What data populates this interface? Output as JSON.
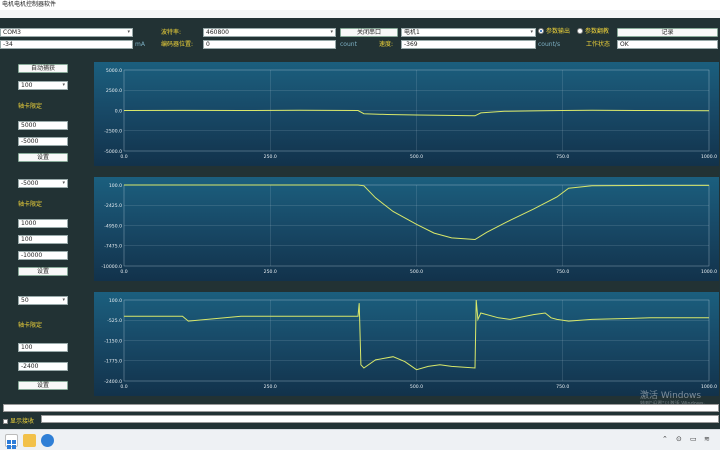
{
  "window": {
    "title": "电机电机控制器软件"
  },
  "top": {
    "port_value": "COM3",
    "baud_label": "波特率:",
    "baud_value": "460800",
    "close_port_label": "关闭串口",
    "motor_value": "电机1",
    "radio_output_label": "参数输出",
    "radio_read_label": "参数翻教",
    "record_label": "记录",
    "current_value": "-34",
    "current_unit": "mA",
    "encoder_label": "编码器位置:",
    "encoder_value": "0",
    "encoder_unit": "count",
    "speed_label": "速度:",
    "speed_value": "-369",
    "speed_unit": "count/s",
    "work_state_label": "工作状态",
    "work_state_value": "OK"
  },
  "left_panel": {
    "auto_capture_label": "自动捕获",
    "p1": {
      "select_value": "100",
      "axis_label": "轴卡限定",
      "max_value": "5000",
      "min_value": "-5000",
      "set_label": "设置"
    },
    "p2": {
      "select_value": "-5000",
      "axis_label": "轴卡限定",
      "v1": "1000",
      "v2": "100",
      "v3": "-10000",
      "set_label": "设置"
    },
    "p3": {
      "select_value": "50",
      "axis_label": "轴卡限定",
      "v1": "100",
      "v2": "-2400",
      "set_label": "设置"
    }
  },
  "bottom": {
    "show_receive_label": "显示接收"
  },
  "watermark": {
    "title": "激活 Windows",
    "subtitle": "转到\"设置\"以激活 Windows。"
  },
  "taskbar": {
    "tray_time": ""
  },
  "chart_data": [
    {
      "type": "line",
      "title": "",
      "xlim": [
        0,
        1000
      ],
      "ylim": [
        -5000,
        5000
      ],
      "x_ticks": [
        "0.0",
        "250.0",
        "500.0",
        "750.0",
        "1000.0"
      ],
      "y_ticks": [
        "5000.0",
        "2500.0",
        "0.0",
        "-2500.0",
        "-5000.0"
      ],
      "series": [
        {
          "color": "#d9e86a",
          "x": [
            0,
            100,
            200,
            300,
            400,
            410,
            450,
            500,
            550,
            600,
            610,
            650,
            700,
            750,
            800,
            900,
            1000
          ],
          "y": [
            0,
            10,
            0,
            30,
            0,
            -400,
            -500,
            -550,
            -600,
            -650,
            -300,
            -100,
            -50,
            0,
            20,
            0,
            -20
          ]
        }
      ]
    },
    {
      "type": "line",
      "title": "",
      "xlim": [
        0,
        1000
      ],
      "ylim": [
        -10000,
        100
      ],
      "x_ticks": [
        "0.0",
        "250.0",
        "500.0",
        "750.0",
        "1000.0"
      ],
      "y_ticks": [
        "100.0",
        "-2425.0",
        "-4950.0",
        "-7475.0",
        "-10000.0"
      ],
      "series": [
        {
          "color": "#d9e86a",
          "x": [
            0,
            300,
            400,
            410,
            430,
            460,
            500,
            530,
            560,
            600,
            620,
            660,
            700,
            740,
            760,
            800,
            900,
            1000
          ],
          "y": [
            100,
            100,
            100,
            0,
            -1500,
            -3200,
            -4800,
            -5900,
            -6500,
            -6700,
            -5800,
            -4300,
            -2900,
            -1400,
            -300,
            0,
            50,
            50
          ]
        }
      ]
    },
    {
      "type": "line",
      "title": "",
      "xlim": [
        0,
        1000
      ],
      "ylim": [
        -2400,
        100
      ],
      "x_ticks": [
        "0.0",
        "250.0",
        "500.0",
        "750.0",
        "1000.0"
      ],
      "y_ticks": [
        "100.0",
        "-525.0",
        "-1150.0",
        "-1775.0",
        "-2400.0"
      ],
      "series": [
        {
          "color": "#d9e86a",
          "x": [
            0,
            100,
            110,
            200,
            300,
            400,
            402,
            405,
            410,
            430,
            460,
            480,
            500,
            520,
            540,
            560,
            600,
            602,
            605,
            610,
            640,
            660,
            700,
            720,
            730,
            740,
            760,
            800,
            900,
            1000
          ],
          "y": [
            -400,
            -400,
            -550,
            -400,
            -400,
            -400,
            0,
            -1900,
            -2000,
            -1750,
            -1650,
            -1800,
            -2050,
            -1950,
            -1900,
            -1950,
            -2000,
            100,
            -500,
            -300,
            -450,
            -500,
            -350,
            -300,
            -450,
            -500,
            -550,
            -500,
            -450,
            -450
          ]
        }
      ]
    }
  ]
}
